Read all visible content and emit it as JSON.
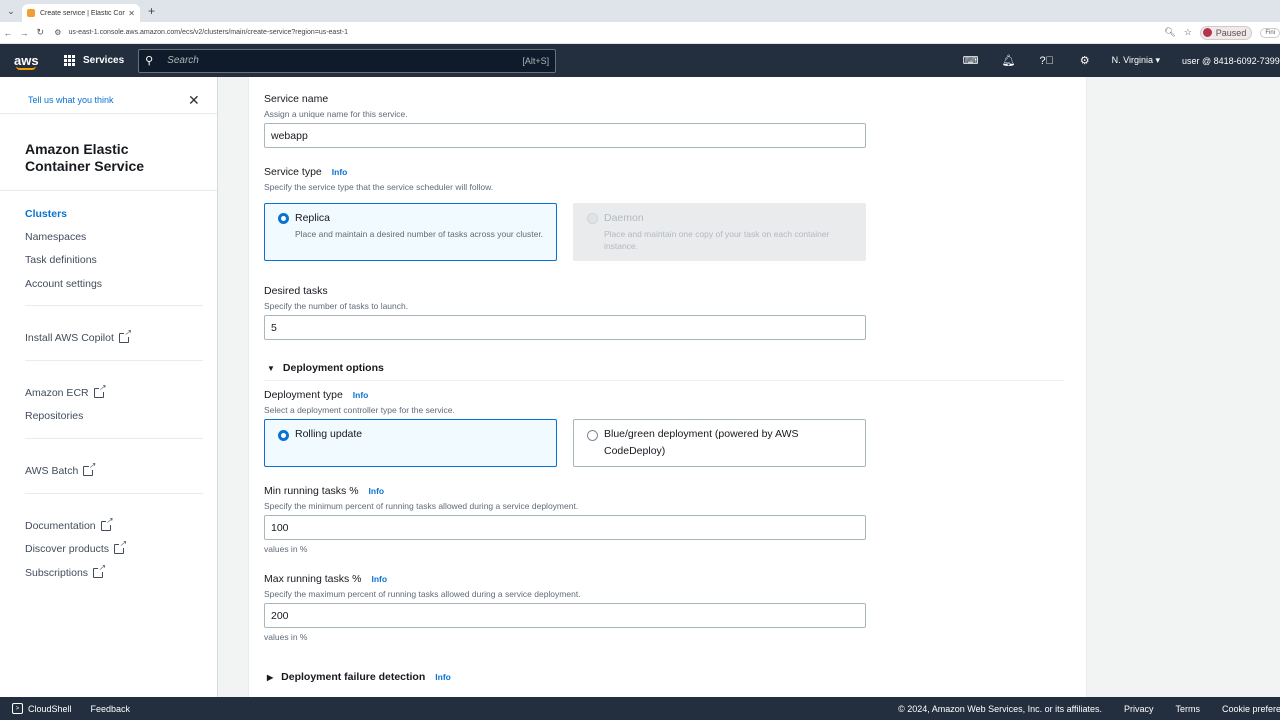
{
  "browser": {
    "tab_title": "Create service | Elastic Container Service",
    "url": "us-east-1.console.aws.amazon.com/ecs/v2/clusters/main/create-service?region=us-east-1",
    "profile_label": "Paused",
    "extra_label": "Fini"
  },
  "awsnav": {
    "logo": "aws",
    "services_label": "Services",
    "search_placeholder": "Search",
    "search_shortcut": "[Alt+S]",
    "region": "N. Virginia ▾",
    "user": "user @ 8418-6092-7399"
  },
  "sidebar": {
    "feedback_link": "Tell us what you think",
    "title": "Amazon Elastic Container Service",
    "nav": [
      "Clusters",
      "Namespaces",
      "Task definitions",
      "Account settings"
    ],
    "install_copilot": "Install AWS Copilot",
    "ecr": "Amazon ECR",
    "repositories": "Repositories",
    "batch": "AWS Batch",
    "documentation": "Documentation",
    "discover": "Discover products",
    "subscriptions": "Subscriptions"
  },
  "form": {
    "service_name_label": "Service name",
    "service_name_desc": "Assign a unique name for this service.",
    "service_name_value": "webapp",
    "service_type_label": "Service type",
    "info": "Info",
    "service_type_desc": "Specify the service type that the service scheduler will follow.",
    "replica_title": "Replica",
    "replica_desc": "Place and maintain a desired number of tasks across your cluster.",
    "daemon_title": "Daemon",
    "daemon_desc": "Place and maintain one copy of your task on each container instance.",
    "desired_tasks_label": "Desired tasks",
    "desired_tasks_desc": "Specify the number of tasks to launch.",
    "desired_tasks_value": "5",
    "deployment_options": "Deployment options",
    "deployment_type_label": "Deployment type",
    "deployment_type_desc": "Select a deployment controller type for the service.",
    "rolling_update": "Rolling update",
    "blue_green": "Blue/green deployment (powered by AWS CodeDeploy)",
    "min_running_label": "Min running tasks %",
    "min_running_desc": "Specify the minimum percent of running tasks allowed during a service deployment.",
    "min_running_value": "100",
    "values_in_percent": "values in %",
    "max_running_label": "Max running tasks %",
    "max_running_desc": "Specify the maximum percent of running tasks allowed during a service deployment.",
    "max_running_value": "200",
    "failure_detection": "Deployment failure detection"
  },
  "footer": {
    "cloudshell": "CloudShell",
    "feedback": "Feedback",
    "copyright": "© 2024, Amazon Web Services, Inc. or its affiliates.",
    "privacy": "Privacy",
    "terms": "Terms",
    "cookie": "Cookie preferences"
  }
}
